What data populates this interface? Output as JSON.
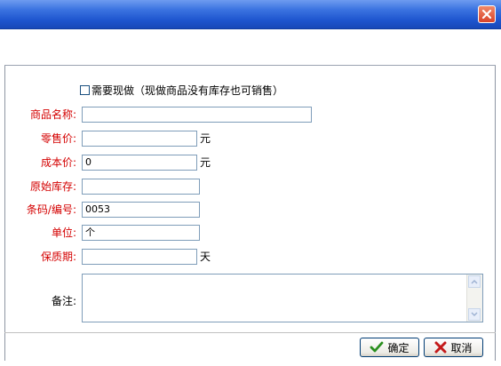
{
  "dialog": {
    "close_icon": "close-x-icon"
  },
  "form": {
    "made_to_order_label": "需要现做（现做商品没有库存也可销售）",
    "made_to_order_checked": false,
    "fields": {
      "product_name": {
        "label": "商品名称:",
        "value": ""
      },
      "retail_price": {
        "label": "零售价:",
        "value": "",
        "unit": "元"
      },
      "cost_price": {
        "label": "成本价:",
        "value": "0",
        "unit": "元"
      },
      "initial_stock": {
        "label": "原始库存:",
        "value": ""
      },
      "barcode": {
        "label": "条码/编号:",
        "value": "0053"
      },
      "unit_of_measure": {
        "label": "单位:",
        "value": "个"
      },
      "shelf_life": {
        "label": "保质期:",
        "value": "",
        "unit": "天"
      },
      "remarks": {
        "label": "备注:",
        "value": ""
      }
    }
  },
  "footer": {
    "ok_label": "确定",
    "ok_icon": "checkmark-icon",
    "cancel_label": "取消",
    "cancel_icon": "x-mark-icon"
  },
  "colors": {
    "required_label": "#d40000",
    "title_bar": "#1f56cf",
    "field_border": "#7f9db9"
  }
}
